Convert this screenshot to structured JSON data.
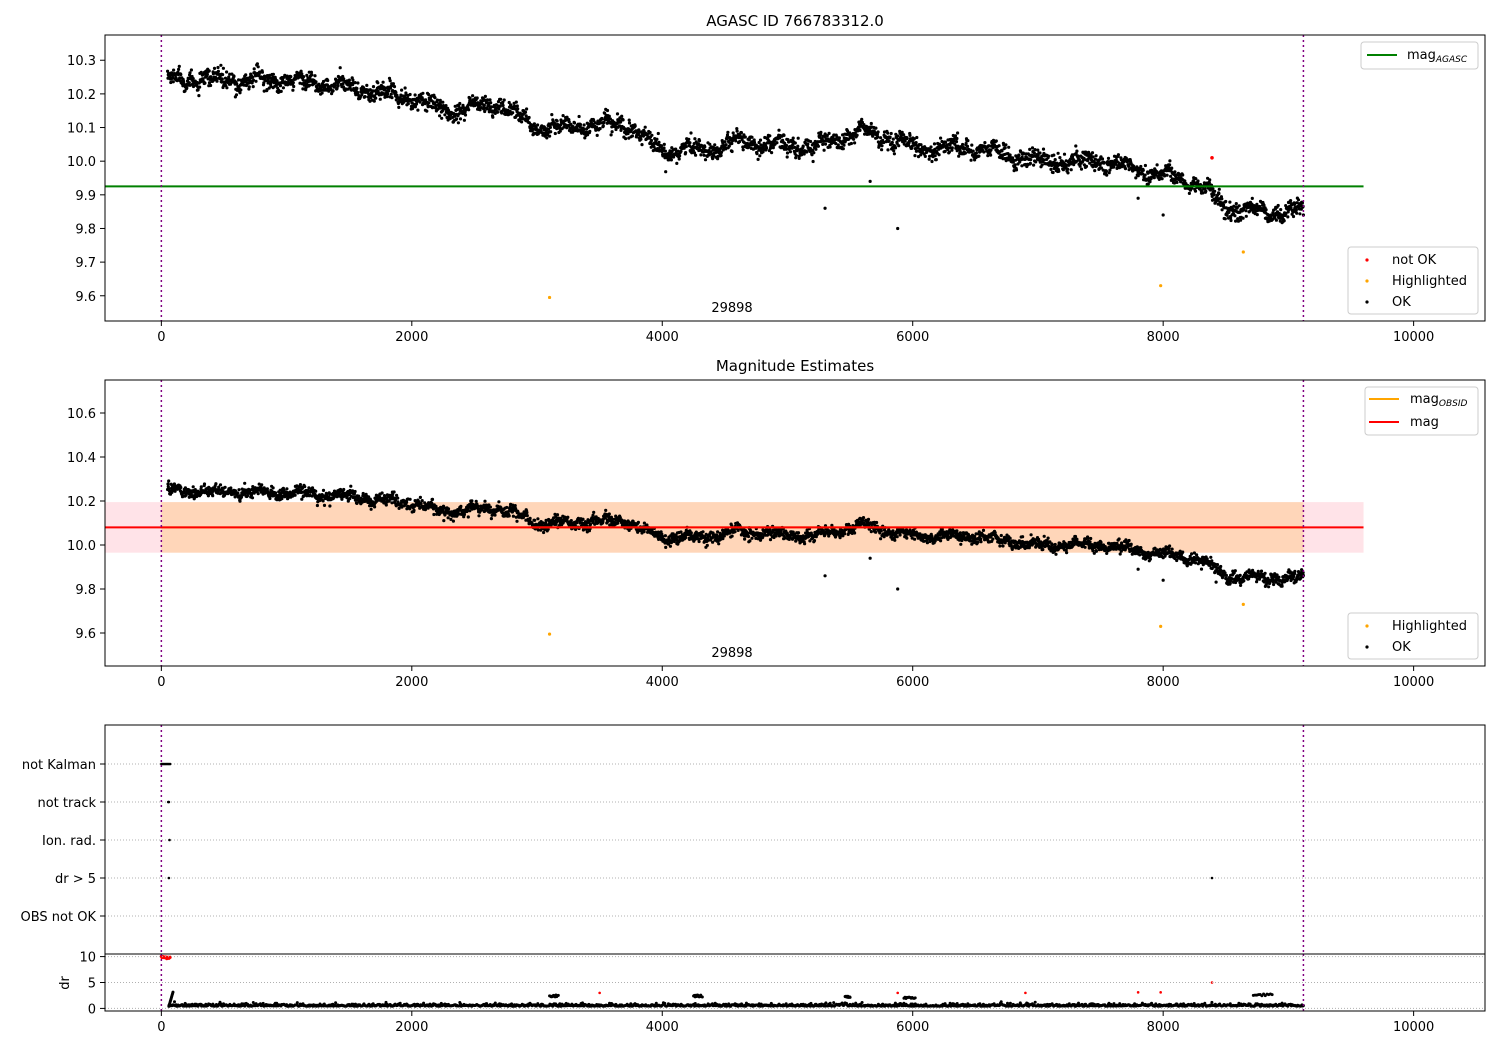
{
  "chart_data": [
    {
      "type": "scatter",
      "title": "AGASC ID 766783312.0",
      "xlim": [
        -450,
        10570
      ],
      "ylim": [
        9.525,
        10.375
      ],
      "xticks": [
        0,
        2000,
        4000,
        6000,
        8000,
        10000
      ],
      "yticks": [
        9.6,
        9.7,
        9.8,
        9.9,
        10.0,
        10.1,
        10.2,
        10.3
      ],
      "obs_boundaries": [
        0,
        9120
      ],
      "lines": [
        {
          "name": "mag_AGASC",
          "legend_main": "mag",
          "legend_sub": "AGASC",
          "color": "#008000",
          "y": 9.925,
          "x_range": [
            -450,
            9600
          ]
        }
      ],
      "trend": {
        "x": [
          50,
          400,
          1000,
          1500,
          2000,
          2250,
          2700,
          3000,
          3200,
          3700,
          4000,
          4400,
          4600,
          5200,
          5600,
          6000,
          6500,
          7000,
          7500,
          8000,
          8300,
          8500,
          8800,
          9120
        ],
        "y": [
          10.245,
          10.24,
          10.24,
          10.22,
          10.19,
          10.15,
          10.17,
          10.1,
          10.1,
          10.11,
          10.03,
          10.04,
          10.06,
          10.04,
          10.09,
          10.04,
          10.04,
          10.0,
          10.0,
          9.96,
          9.93,
          9.86,
          9.85,
          9.85
        ],
        "spread": 0.022
      },
      "points": {
        "not_ok": [
          {
            "x": 8390,
            "y": 10.01
          }
        ],
        "highlighted": [
          {
            "x": 3100,
            "y": 9.595
          },
          {
            "x": 7980,
            "y": 9.63
          },
          {
            "x": 8640,
            "y": 9.73
          }
        ],
        "ok_outliers": [
          {
            "x": 5300,
            "y": 9.86
          },
          {
            "x": 5880,
            "y": 9.8
          },
          {
            "x": 5660,
            "y": 9.94
          },
          {
            "x": 8000,
            "y": 9.84
          },
          {
            "x": 7800,
            "y": 9.89
          }
        ]
      },
      "annotation": {
        "text": "29898",
        "x": 4550,
        "y": 9.555
      },
      "legends": {
        "top": [
          "mag_AGASC"
        ],
        "bottom": [
          "not OK",
          "Highlighted",
          "OK"
        ]
      },
      "colors": {
        "ok": "#000000",
        "not_ok": "#ff0000",
        "highlighted": "#ffa500",
        "boundary": "#800080"
      }
    },
    {
      "type": "scatter",
      "title": "Magnitude Estimates",
      "xlim": [
        -450,
        10570
      ],
      "ylim": [
        9.45,
        10.75
      ],
      "xticks": [
        0,
        2000,
        4000,
        6000,
        8000,
        10000
      ],
      "yticks": [
        9.6,
        9.8,
        10.0,
        10.2,
        10.4,
        10.6
      ],
      "obs_boundaries": [
        0,
        9120
      ],
      "lines": [
        {
          "name": "mag_OBSID",
          "legend_main": "mag",
          "legend_sub": "OBSID",
          "color": "#ffa500",
          "y": 10.08,
          "x_range": [
            0,
            9120
          ]
        },
        {
          "name": "mag",
          "legend_main": "mag",
          "legend_sub": "",
          "color": "#ff0000",
          "y": 10.08,
          "x_range": [
            -450,
            9600
          ]
        }
      ],
      "bands": [
        {
          "color": "#ffc0cb",
          "y_range": [
            9.965,
            10.195
          ],
          "x_range": [
            -450,
            9600
          ],
          "alpha": 0.45
        },
        {
          "color": "#ffa500",
          "y_range": [
            9.965,
            10.195
          ],
          "x_range": [
            0,
            9120
          ],
          "alpha": 0.2
        }
      ],
      "trend": {
        "x": [
          50,
          400,
          1000,
          1500,
          2000,
          2250,
          2700,
          3000,
          3200,
          3700,
          4000,
          4400,
          4600,
          5200,
          5600,
          6000,
          6500,
          7000,
          7500,
          8000,
          8300,
          8500,
          8800,
          9120
        ],
        "y": [
          10.245,
          10.24,
          10.24,
          10.22,
          10.19,
          10.15,
          10.17,
          10.1,
          10.1,
          10.11,
          10.03,
          10.04,
          10.06,
          10.04,
          10.09,
          10.04,
          10.04,
          10.0,
          10.0,
          9.96,
          9.93,
          9.86,
          9.85,
          9.85
        ],
        "spread": 0.022
      },
      "points": {
        "highlighted": [
          {
            "x": 3100,
            "y": 9.595
          },
          {
            "x": 7980,
            "y": 9.63
          },
          {
            "x": 8640,
            "y": 9.73
          }
        ],
        "ok_outliers": [
          {
            "x": 5300,
            "y": 9.86
          },
          {
            "x": 5880,
            "y": 9.8
          },
          {
            "x": 5660,
            "y": 9.94
          },
          {
            "x": 8000,
            "y": 9.84
          },
          {
            "x": 7800,
            "y": 9.89
          }
        ]
      },
      "annotation": {
        "text": "29898",
        "x": 4550,
        "y": 9.5
      },
      "legends": {
        "top": [
          "mag_OBSID",
          "mag"
        ],
        "bottom": [
          "Highlighted",
          "OK"
        ]
      },
      "colors": {
        "ok": "#000000",
        "highlighted": "#ffa500",
        "boundary": "#800080"
      }
    },
    {
      "type": "scatter",
      "title": "",
      "xlim": [
        -450,
        10570
      ],
      "categories": [
        "not Kalman",
        "not track",
        "Ion. rad.",
        "dr > 5",
        "OBS not OK"
      ],
      "flag_points": [
        {
          "category": "not Kalman",
          "x": [
            0,
            10,
            20,
            30,
            40,
            50,
            60,
            70
          ]
        },
        {
          "category": "not track",
          "x": [
            55,
            60
          ]
        },
        {
          "category": "Ion. rad.",
          "x": [
            65
          ]
        },
        {
          "category": "dr > 5",
          "x": [
            60,
            8390
          ]
        },
        {
          "category": "OBS not OK",
          "x": []
        }
      ],
      "obs_boundaries": [
        0,
        9120
      ],
      "colors": {
        "points": "#000000",
        "grid": "#b0b0b0",
        "boundary": "#800080"
      }
    },
    {
      "type": "scatter",
      "title": "",
      "ylabel": "dr",
      "xlim": [
        -450,
        10570
      ],
      "ylim": [
        -0.5,
        10.5
      ],
      "xticks": [
        0,
        2000,
        4000,
        6000,
        8000,
        10000
      ],
      "yticks": [
        0,
        5,
        10
      ],
      "baseline": 0.4,
      "red_cluster": {
        "x_range": [
          0,
          70
        ],
        "y": 9.8
      },
      "red_points": [
        {
          "x": 3500,
          "y": 3
        },
        {
          "x": 5880,
          "y": 3
        },
        {
          "x": 6900,
          "y": 3
        },
        {
          "x": 7800,
          "y": 3.1
        },
        {
          "x": 7980,
          "y": 3.1
        },
        {
          "x": 8390,
          "y": 5
        }
      ],
      "bumps": [
        {
          "x_range": [
            3100,
            3170
          ],
          "y": 2.4
        },
        {
          "x_range": [
            4250,
            4320
          ],
          "y": 2.4
        },
        {
          "x_range": [
            5930,
            6020
          ],
          "y": 2.1
        },
        {
          "x_range": [
            5460,
            5500
          ],
          "y": 2.2
        },
        {
          "x_range": [
            8720,
            8870
          ],
          "y": 2.6
        }
      ],
      "obs_boundaries": [
        0,
        9120
      ],
      "colors": {
        "ok": "#000000",
        "red": "#ff0000",
        "boundary": "#800080"
      }
    }
  ]
}
